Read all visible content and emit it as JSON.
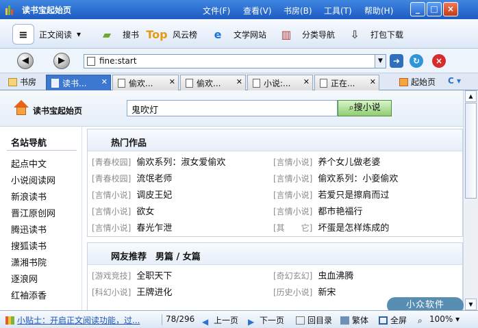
{
  "window": {
    "title": "读书宝起始页",
    "menu": [
      "文件(F)",
      "查看(V)",
      "书房(B)",
      "工具(T)",
      "帮助(H)"
    ],
    "controls": [
      "_",
      "□",
      "×"
    ]
  },
  "toolbar": {
    "reader": "正文阅读",
    "search": "搜书",
    "ranking": "风云榜",
    "literature": "文学网站",
    "categories": "分类导航",
    "download": "打包下载"
  },
  "address": {
    "url": "fine:start"
  },
  "tabs": {
    "library": "书房",
    "items": [
      "读书...",
      "偷欢...",
      "偷欢...",
      "小说:...",
      "正在..."
    ],
    "home": "起始页"
  },
  "header": {
    "home_label": "读书宝起始页",
    "search_value": "鬼吹灯",
    "search_button": "搜小说"
  },
  "sidebar": {
    "title": "名站导航",
    "items": [
      "起点中文",
      "小说阅读网",
      "新浪读书",
      "晋江原创网",
      "腾迅读书",
      "搜狐读书",
      "潇湘书院",
      "逐浪网",
      "红袖添香"
    ]
  },
  "sections": [
    {
      "title": "热门作品",
      "items": [
        {
          "tag": "[青春校园]",
          "title": "偷欢系列：淑女爱偷欢"
        },
        {
          "tag": "[言情小说]",
          "title": "养个女儿做老婆"
        },
        {
          "tag": "[青春校园]",
          "title": "流氓老师"
        },
        {
          "tag": "[言情小说]",
          "title": "偷欢系列：小妾偷欢"
        },
        {
          "tag": "[言情小说]",
          "title": "调皮王妃"
        },
        {
          "tag": "[言情小说]",
          "title": "若爱只是擦肩而过"
        },
        {
          "tag": "[言情小说]",
          "title": "欲女"
        },
        {
          "tag": "[言情小说]",
          "title": "都市艳福行"
        },
        {
          "tag": "[言情小说]",
          "title": "春光乍泄"
        },
        {
          "tag": "[其　　它]",
          "title": "坏蛋是怎样炼成的"
        }
      ]
    },
    {
      "title": "网友推荐　男篇 / 女篇",
      "items": [
        {
          "tag": "[游戏竞技]",
          "title": "全职天下"
        },
        {
          "tag": "[奇幻玄幻]",
          "title": "虫血沸腾"
        },
        {
          "tag": "[科幻小说]",
          "title": "王牌进化"
        },
        {
          "tag": "[历史小说]",
          "title": "新宋"
        }
      ]
    }
  ],
  "watermark": "小众软件",
  "status": {
    "tip": "小贴士：开启正文阅读功能，过...",
    "page": "78/296",
    "prev": "上一页",
    "next": "下一页",
    "toc": "回目录",
    "traditional": "繁体",
    "fullscreen": "全屏",
    "zoom": "100%"
  }
}
